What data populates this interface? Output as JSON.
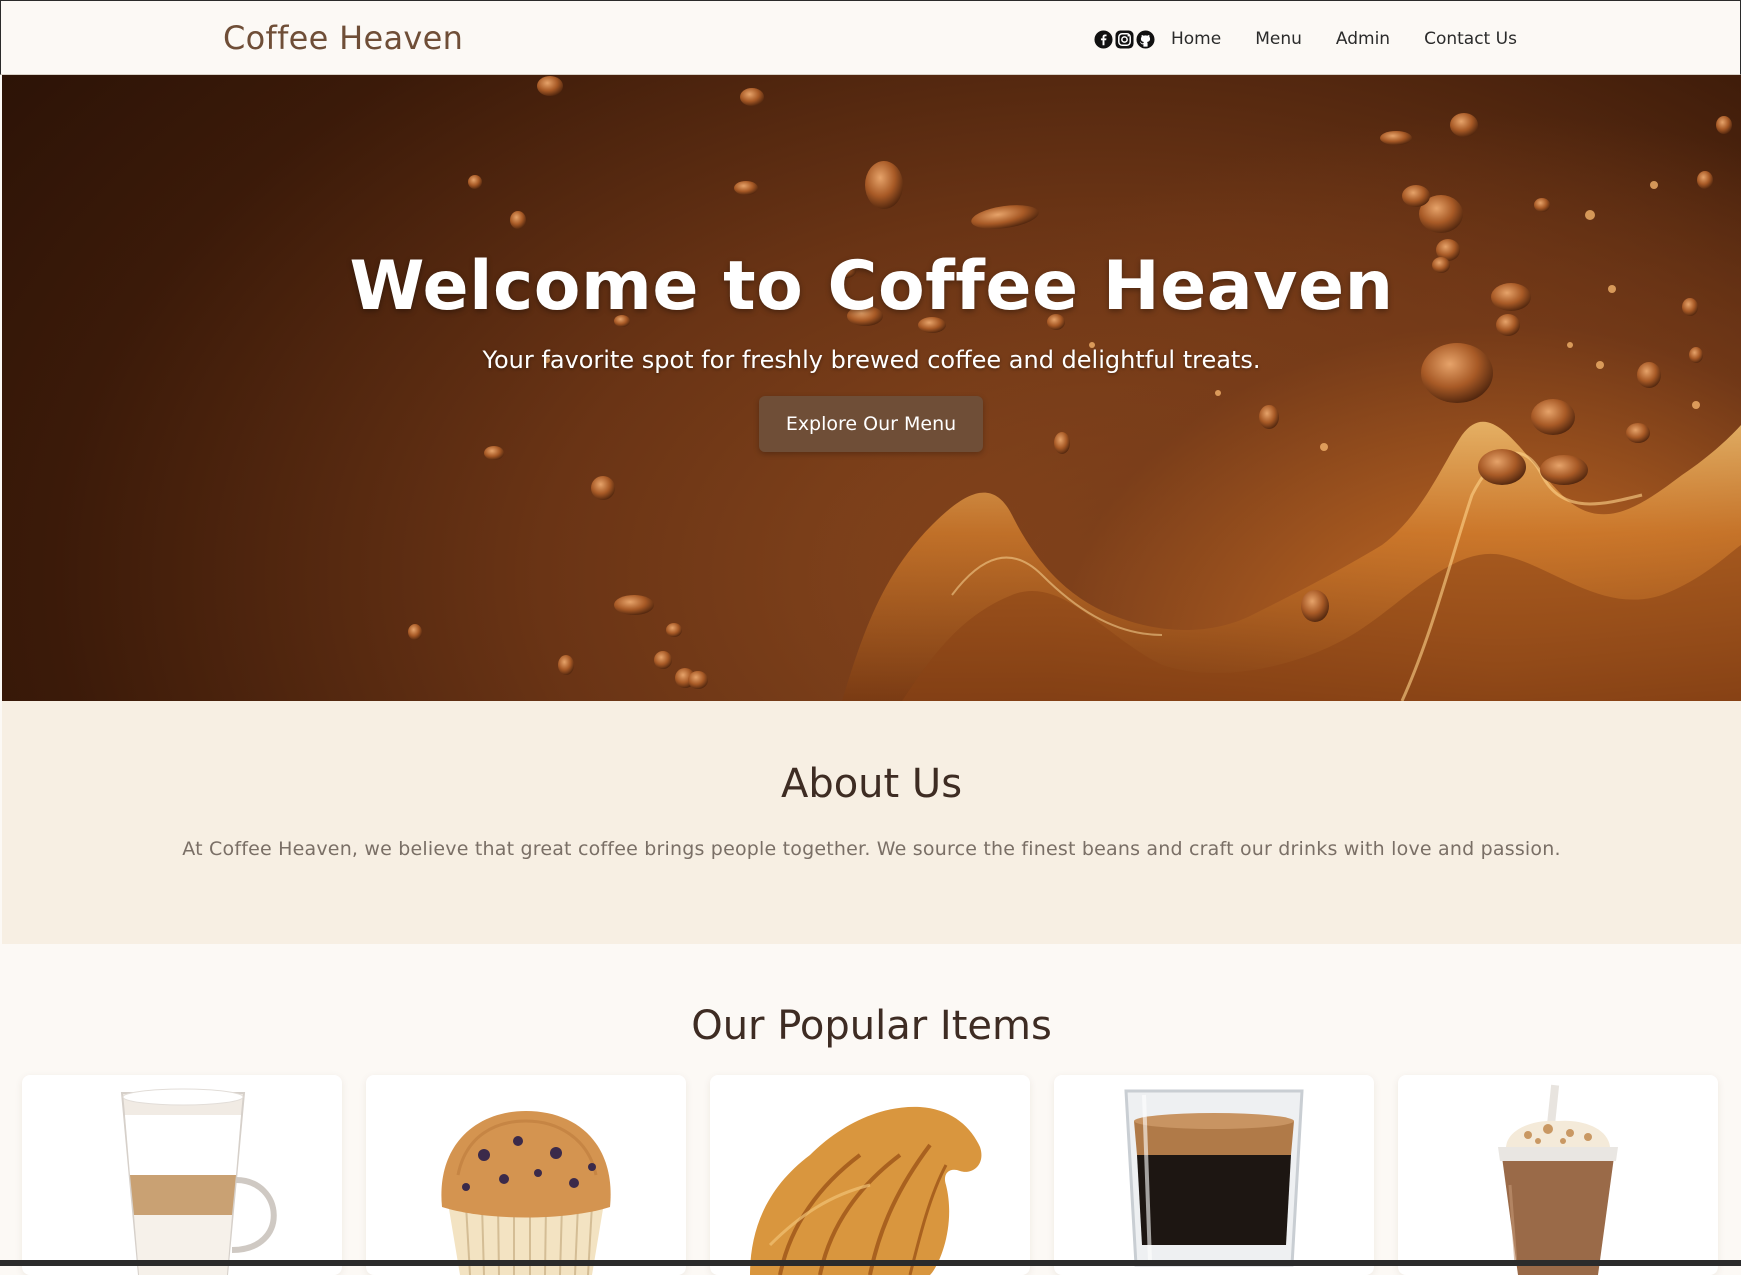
{
  "navbar": {
    "brand": "Coffee Heaven",
    "social_icons": [
      "facebook-icon",
      "instagram-icon",
      "github-icon"
    ],
    "links": [
      "Home",
      "Menu",
      "Admin",
      "Contact Us"
    ]
  },
  "hero": {
    "title": "Welcome to Coffee Heaven",
    "subtitle": "Your favorite spot for freshly brewed coffee and delightful treats.",
    "button_label": "Explore Our Menu"
  },
  "about": {
    "title": "About Us",
    "text": "At Coffee Heaven, we believe that great coffee brings people together. We source the finest beans and craft our drinks with love and passion."
  },
  "popular": {
    "title": "Our Popular Items",
    "items": [
      "latte-image",
      "blueberry-muffin-image",
      "croissant-image",
      "espresso-image",
      "iced-frappe-image"
    ]
  },
  "colors": {
    "brand": "#6f4e37",
    "background": "#fcf9f5",
    "about_background": "#f7efe3",
    "heading": "#3e2c23"
  }
}
